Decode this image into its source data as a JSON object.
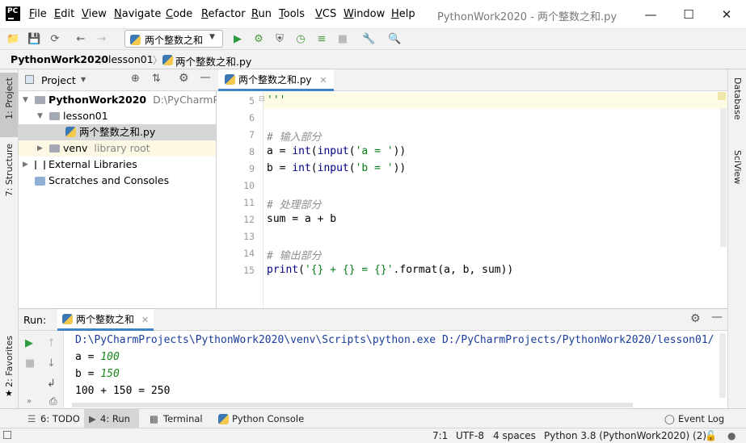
{
  "app": {
    "logo": "PC",
    "window_title": "PythonWork2020 - 两个整数之和.py"
  },
  "menu": [
    {
      "label": "File",
      "u": "F",
      "rest": "ile"
    },
    {
      "label": "Edit",
      "u": "E",
      "rest": "dit"
    },
    {
      "label": "View",
      "u": "V",
      "rest": "iew"
    },
    {
      "label": "Navigate",
      "u": "N",
      "rest": "avigate"
    },
    {
      "label": "Code",
      "u": "C",
      "rest": "ode"
    },
    {
      "label": "Refactor",
      "u": "R",
      "rest": "efactor"
    },
    {
      "label": "Run",
      "u": "R",
      "rest": "un"
    },
    {
      "label": "Tools",
      "u": "T",
      "rest": "ools"
    },
    {
      "label": "VCS",
      "u": "V",
      "rest": "CS"
    },
    {
      "label": "Window",
      "u": "W",
      "rest": "indow"
    },
    {
      "label": "Help",
      "u": "H",
      "rest": "elp"
    }
  ],
  "toolbar": {
    "run_config": "两个整数之和"
  },
  "breadcrumb": {
    "project": "PythonWork2020",
    "folder": "lesson01",
    "file": "两个整数之和.py"
  },
  "left_stripe": {
    "project": "1: Project",
    "structure": "7: Structure",
    "favorites": "2: Favorites"
  },
  "right_stripe": {
    "database": "Database",
    "sciview": "SciView"
  },
  "project_panel": {
    "title": "Project",
    "root_name": "PythonWork2020",
    "root_path": "D:\\PyCharmProje",
    "lesson": "lesson01",
    "file": "两个整数之和.py",
    "venv": "venv",
    "venv_note": "library root",
    "external": "External Libraries",
    "scratches": "Scratches and Consoles"
  },
  "editor": {
    "tab": "两个整数之和.py",
    "lines": [
      {
        "num": "5",
        "text": "'''"
      },
      {
        "num": "6",
        "text": ""
      },
      {
        "num": "7",
        "text": "# 输入部分"
      },
      {
        "num": "8",
        "pre": "a = ",
        "b1": "int",
        "p1": "(",
        "b2": "input",
        "p2": "(",
        "s": "'a = '",
        "post": "))"
      },
      {
        "num": "9",
        "pre": "b = ",
        "b1": "int",
        "p1": "(",
        "b2": "input",
        "p2": "(",
        "s": "'b = '",
        "post": "))"
      },
      {
        "num": "10",
        "text": ""
      },
      {
        "num": "11",
        "text": "# 处理部分"
      },
      {
        "num": "12",
        "text": "sum = a + b"
      },
      {
        "num": "13",
        "text": ""
      },
      {
        "num": "14",
        "text": "# 输出部分"
      },
      {
        "num": "15",
        "b1": "print",
        "p1": "(",
        "s": "'{} + {} = {}'",
        "post": ".format(a, b, sum))"
      }
    ]
  },
  "run_panel": {
    "label": "Run:",
    "tab": "两个整数之和",
    "output": {
      "cmd": "D:\\PyCharmProjects\\PythonWork2020\\venv\\Scripts\\python.exe D:/PyCharmProjects/PythonWork2020/lesson01/",
      "prompt_a": "a = ",
      "input_a": "100",
      "prompt_b": "b = ",
      "input_b": "150",
      "result": "100 + 150 = 250"
    }
  },
  "bottom_tabs": {
    "todo": "6: TODO",
    "run": "4: Run",
    "terminal": "Terminal",
    "console": "Python Console",
    "event_log": "Event Log"
  },
  "status": {
    "position": "7:1",
    "encoding": "UTF-8",
    "indent": "4 spaces",
    "interpreter": "Python 3.8 (PythonWork2020) (2)"
  }
}
